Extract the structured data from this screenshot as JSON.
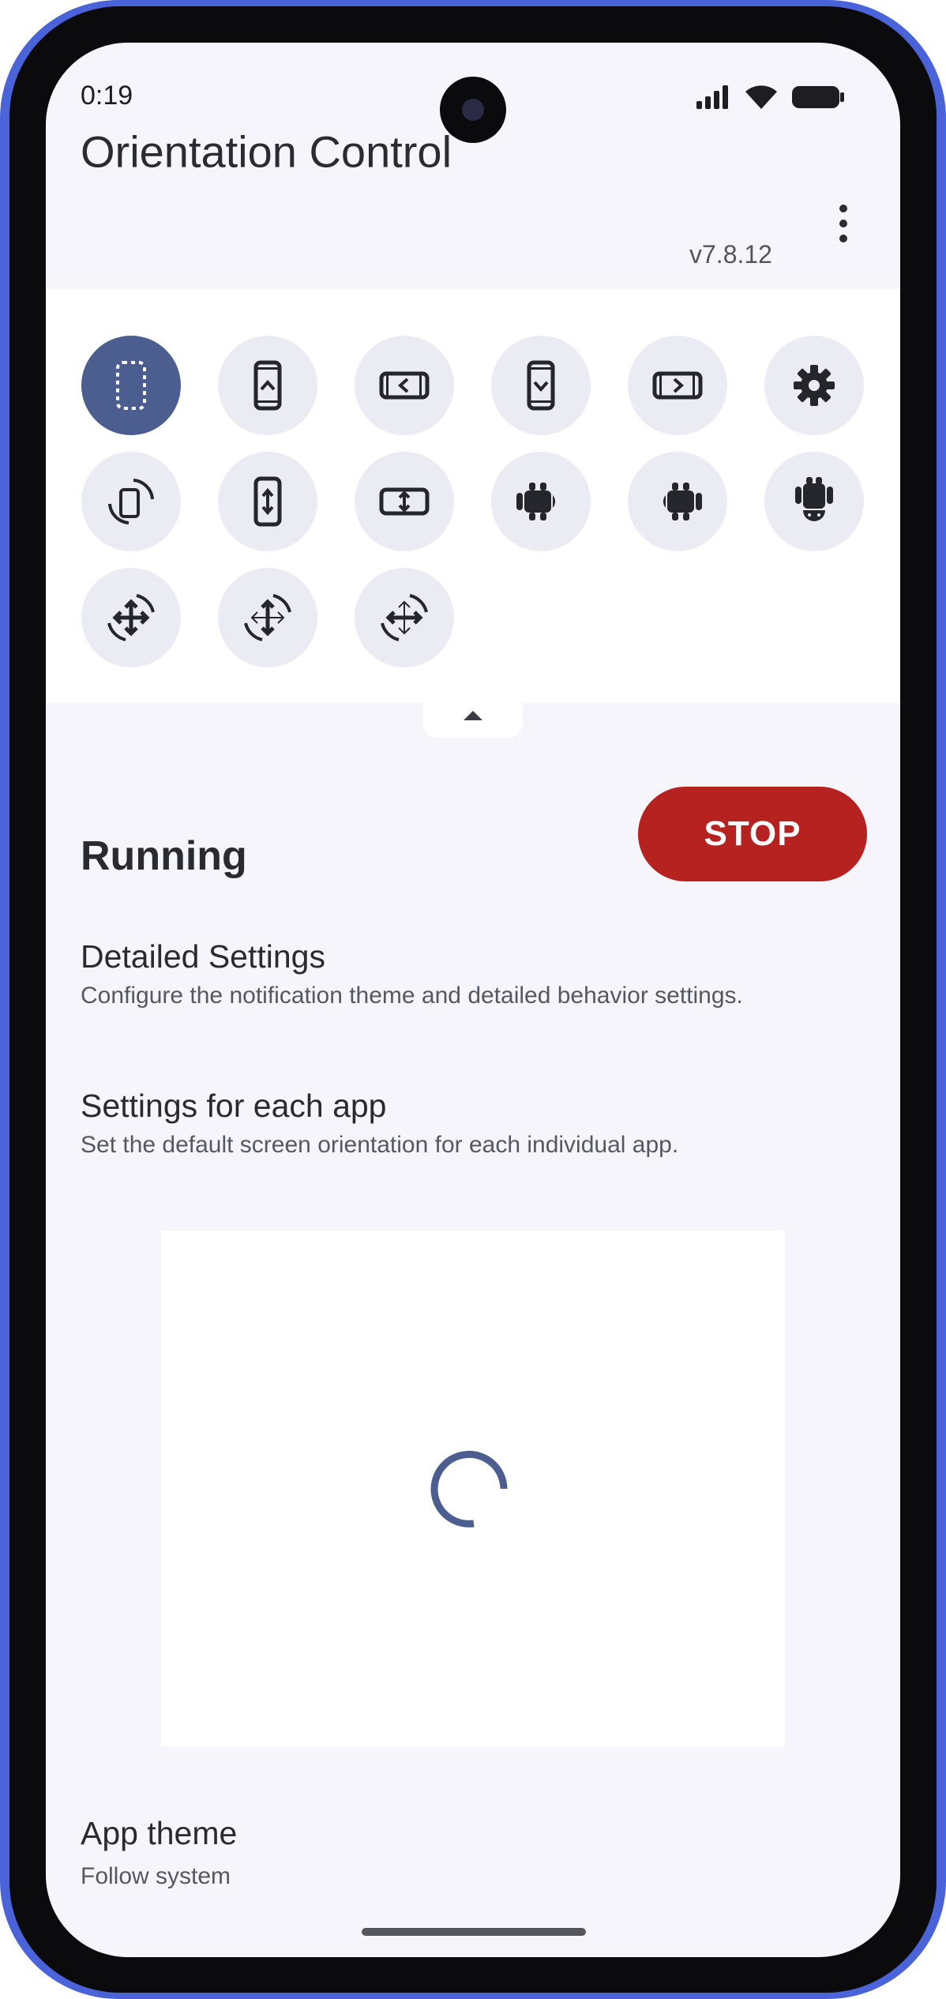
{
  "status_bar": {
    "time": "0:19",
    "icons": [
      "signal-icon",
      "wifi-icon",
      "battery-icon"
    ]
  },
  "app_bar": {
    "title": "Orientation Control",
    "version": "v7.8.12",
    "menu_icon": "more-vert-icon"
  },
  "orientation_buttons": [
    {
      "name": "unspecified-orientation",
      "icon": "dotted-phone-icon",
      "active": true
    },
    {
      "name": "portrait",
      "icon": "phone-portrait-up-icon",
      "active": false
    },
    {
      "name": "landscape",
      "icon": "phone-landscape-left-icon",
      "active": false
    },
    {
      "name": "reverse-portrait",
      "icon": "phone-portrait-down-icon",
      "active": false
    },
    {
      "name": "reverse-landscape",
      "icon": "phone-landscape-right-icon",
      "active": false
    },
    {
      "name": "settings",
      "icon": "gear-icon",
      "active": false
    },
    {
      "name": "full-sensor",
      "icon": "phone-rotate-icon",
      "active": false
    },
    {
      "name": "sensor-portrait",
      "icon": "phone-portrait-both-icon",
      "active": false
    },
    {
      "name": "sensor-landscape",
      "icon": "phone-landscape-both-icon",
      "active": false
    },
    {
      "name": "android-landscape-left",
      "icon": "android-landscape-left-icon",
      "active": false
    },
    {
      "name": "android-landscape-right",
      "icon": "android-landscape-right-icon",
      "active": false
    },
    {
      "name": "android-reverse",
      "icon": "android-upside-down-icon",
      "active": false
    },
    {
      "name": "force-sensor",
      "icon": "rotate-arrows-icon",
      "active": false
    },
    {
      "name": "force-sensor-portrait",
      "icon": "rotate-arrows-portrait-icon",
      "active": false
    },
    {
      "name": "force-sensor-landscape",
      "icon": "rotate-arrows-landscape-icon",
      "active": false
    }
  ],
  "collapse_icon": "chevron-up-icon",
  "service": {
    "status": "Running",
    "stop_label": "STOP"
  },
  "settings": [
    {
      "title": "Detailed Settings",
      "subtitle": "Configure the notification theme and detailed behavior settings."
    },
    {
      "title": "Settings for each app",
      "subtitle": "Set the default screen orientation for each individual app."
    }
  ],
  "theme": {
    "title": "App theme",
    "value": "Follow system"
  },
  "colors": {
    "accent": "#4b5e8f",
    "stop": "#b5221f",
    "button_bg": "#ebebf4",
    "frame": "#4a63d8"
  }
}
